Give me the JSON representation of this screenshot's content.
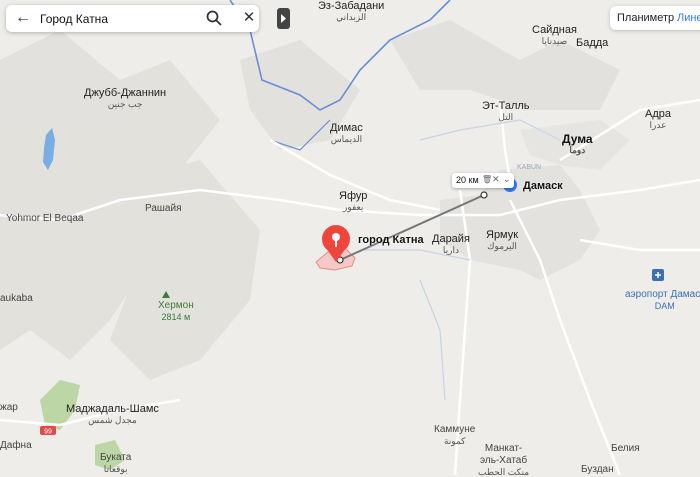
{
  "search": {
    "query": "Город Катна",
    "back_icon": "arrow-left-icon",
    "search_icon": "search-icon",
    "clear_icon": "close-icon"
  },
  "layers": {
    "ruler_label": "Планиметр",
    "line_label": "Лине"
  },
  "ruler": {
    "distance": "20 км"
  },
  "places": {
    "ez_zabadani": "Эз-Забадани",
    "ez_zabadani_ar": "الزبداني",
    "saidnaya": "Сайдная",
    "saidnaya_ar": "صيدنايا",
    "badda": "Бадда",
    "juhb_jannin": "Джубб-Джаннин",
    "juhb_jannin_ar": "جب جنين",
    "et_tall": "Эт-Талль",
    "et_tall_ar": "التل",
    "adra": "Адра",
    "adra_ar": "عدرا",
    "dimas": "Димас",
    "dimas_ar": "الديماس",
    "duma": "Дума",
    "duma_ar": "دوما",
    "kabun": "KABUN",
    "damask": "Дамаск",
    "yafur": "Яфур",
    "yafur_ar": "يعفور",
    "yohmor": "Yohmor El Beqaa",
    "rashaya": "Рашайя",
    "katna": "город Катна",
    "darayya": "Дарайя",
    "darayya_ar": "داريا",
    "yarmuk": "Ярмук",
    "yarmuk_ar": "اليرموك",
    "airport": "аэропорт Дамаск",
    "airport_code": "DAM",
    "hermon": "Хермон",
    "hermon_elev": "2814 м",
    "aukaba": "aukaba",
    "majdal": "Маджадаль-Шамс",
    "majdal_ar": "مجدل شمس",
    "dzhar": "жар",
    "dafna": "Дафна",
    "road_99": "99",
    "bukata": "Буката",
    "bukata_ar": "بوقعاتا",
    "kammune": "Каммуне",
    "kammune_ar": "كمونة",
    "mankat": "Манкат-",
    "mankat2": "эль-Хатаб",
    "mankat_ar": "منكت الحطب",
    "beliya": "Белия",
    "buzdan": "Буздан"
  },
  "colors": {
    "accent": "#2e7df6",
    "pin": "#f0453a",
    "area_fill": "#f6c9c6"
  }
}
